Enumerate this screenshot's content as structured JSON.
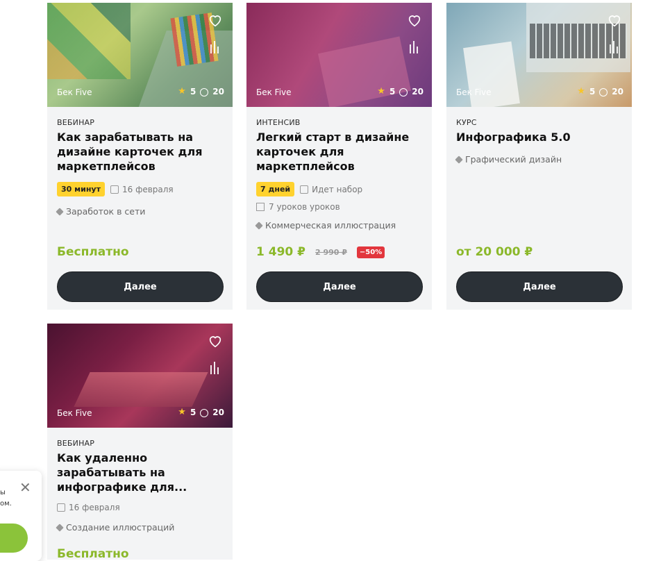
{
  "cards": [
    {
      "author": "Бек Five",
      "rating": "5",
      "comments": "20",
      "type": "ВЕБИНАР",
      "title": "Как зарабатывать на дизайне карточек для маркетплейсов",
      "duration": "30 минут",
      "date": "16 февраля",
      "tag": "Заработок в сети",
      "price": "Бесплатно",
      "button": "Далее"
    },
    {
      "author": "Бек Five",
      "rating": "5",
      "comments": "20",
      "type": "ИНТЕНСИВ",
      "title": "Легкий старт в дизайне карточек для маркетплейсов",
      "duration": "7 дней",
      "status": "Идет набор",
      "lessons": "7 уроков уроков",
      "tag": "Коммерческая иллюстрация",
      "price_now": "1 490 ₽",
      "price_old": "2 990 ₽",
      "discount": "−50%",
      "button": "Далее"
    },
    {
      "author": "Бек Five",
      "rating": "5",
      "comments": "20",
      "type": "КУРС",
      "title": "Инфографика 5.0",
      "tag": "Графический дизайн",
      "price": "от 20 000 ₽",
      "button": "Далее"
    },
    {
      "author": "Бек Five",
      "rating": "5",
      "comments": "20",
      "type": "ВЕБИНАР",
      "title": "Как удаленно зарабатывать на инфографике для...",
      "date": "16 февраля",
      "tag": "Создание иллюстраций",
      "price": "Бесплатно"
    }
  ],
  "cookie": {
    "line1": "ы",
    "line2": "ом.",
    "close": "✕"
  },
  "colors": {
    "price_green": "#8bb82a",
    "button_dark": "#2b3137",
    "badge_yellow": "#ffd22e",
    "discount_red": "#e2363d"
  }
}
